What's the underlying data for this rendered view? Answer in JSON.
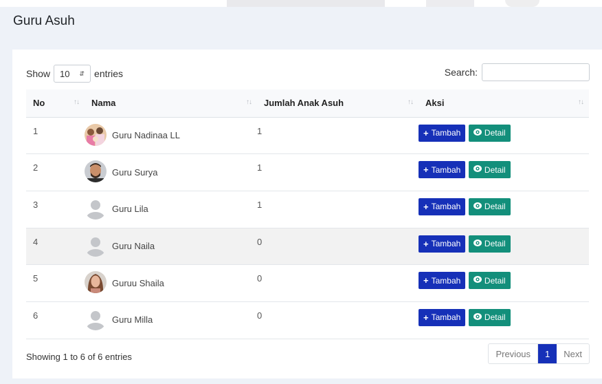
{
  "page": {
    "title": "Guru Asuh"
  },
  "length": {
    "show": "Show",
    "value": "10",
    "entries": "entries"
  },
  "search": {
    "label": "Search:",
    "value": ""
  },
  "table": {
    "headers": [
      "No",
      "Nama",
      "Jumlah Anak Asuh",
      "Aksi"
    ],
    "rows": [
      {
        "no": "1",
        "name": "Guru Nadinaa LL",
        "count": "1",
        "avatar": "group-photo"
      },
      {
        "no": "2",
        "name": "Guru Surya",
        "count": "1",
        "avatar": "man-photo"
      },
      {
        "no": "3",
        "name": "Guru Lila",
        "count": "1",
        "avatar": "default-avatar"
      },
      {
        "no": "4",
        "name": "Guru Naila",
        "count": "0",
        "avatar": "default-avatar"
      },
      {
        "no": "5",
        "name": "Guruu Shaila",
        "count": "0",
        "avatar": "woman-photo"
      },
      {
        "no": "6",
        "name": "Guru Milla",
        "count": "0",
        "avatar": "default-avatar"
      }
    ]
  },
  "actions": {
    "add": "Tambah",
    "detail": "Detail"
  },
  "footer": {
    "info": "Showing 1 to 6 of 6 entries"
  },
  "pagination": {
    "previous": "Previous",
    "current": "1",
    "next": "Next"
  },
  "colors": {
    "primary": "#1630b8",
    "success": "#138f7b",
    "background": "#eef2f8"
  }
}
